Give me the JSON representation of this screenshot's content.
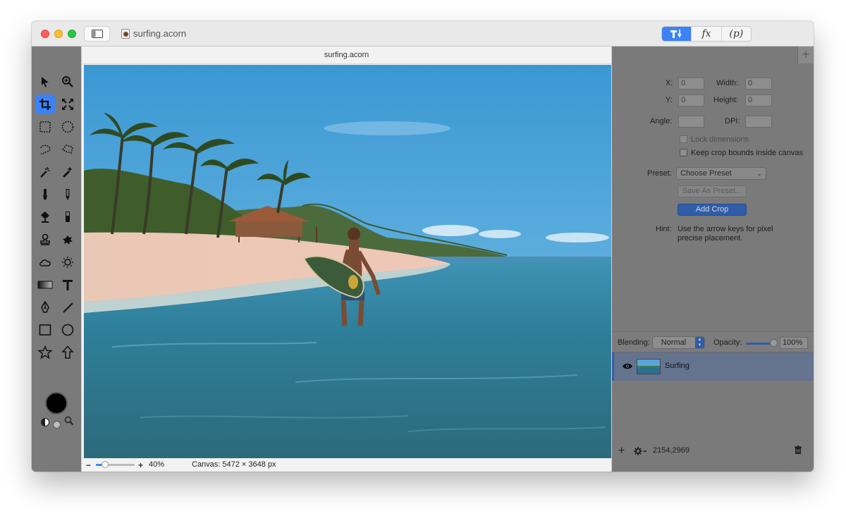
{
  "window": {
    "file_name": "surfing.acorn",
    "canvas_title": "surfing.acorn"
  },
  "toolbar_segments": [
    "fx",
    "(p)"
  ],
  "tools": [
    "move-tool",
    "zoom-tool",
    "crop-tool",
    "transform-tool",
    "rect-select-tool",
    "ellipse-select-tool",
    "lasso-tool",
    "polygon-lasso-tool",
    "magic-wand-tool",
    "magic-brush-tool",
    "brush-tool",
    "pencil-tool",
    "paint-bucket-tool",
    "eraser-tool",
    "clone-stamp-tool",
    "smudge-tool",
    "cloud-tool",
    "sun-tool",
    "gradient-tool",
    "text-tool",
    "pen-tool",
    "line-tool",
    "rectangle-tool",
    "circle-tool",
    "star-tool",
    "arrow-tool"
  ],
  "footer": {
    "zoom_minus": "−",
    "zoom_plus": "+",
    "zoom_value": "40%",
    "canvas_info": "Canvas: 5472 × 3648 px"
  },
  "crop": {
    "x_label": "X:",
    "x_value": "0",
    "y_label": "Y:",
    "y_value": "0",
    "width_label": "Width:",
    "width_value": "0",
    "height_label": "Height:",
    "height_value": "0",
    "angle_label": "Angle:",
    "angle_value": "",
    "dpi_label": "DPI:",
    "dpi_value": "",
    "lock_label": "Lock dimensions",
    "keep_label": "Keep crop bounds inside canvas",
    "preset_label": "Preset:",
    "preset_value": "Choose Preset",
    "save_preset_label": "Save As Preset...",
    "add_crop_label": "Add Crop",
    "hint_label": "Hint:",
    "hint_text_1": "Use the arrow keys for pixel",
    "hint_text_2": "precise placement."
  },
  "layers": {
    "blending_label": "Blending:",
    "blending_value": "Normal",
    "opacity_label": "Opacity:",
    "opacity_value": "100%",
    "opacity": 1.0,
    "items": [
      {
        "name": "Surfing",
        "visible": true
      }
    ]
  },
  "inspector_footer": {
    "coords": "2154,2969"
  },
  "colors": {
    "accent": "#3b82f6",
    "selection": "#2f5da8"
  }
}
